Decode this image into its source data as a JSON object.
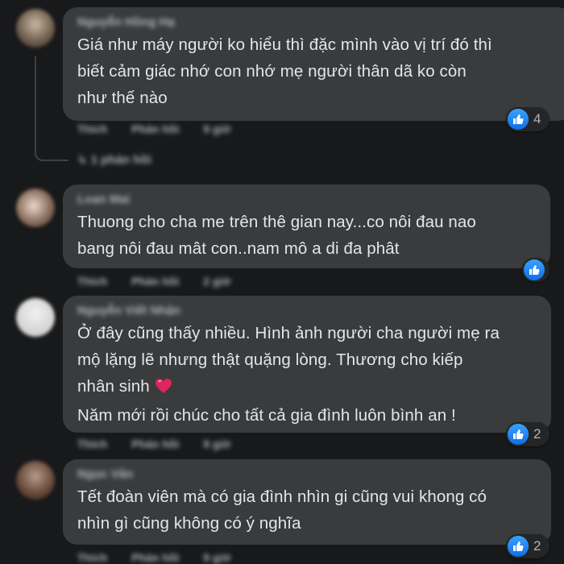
{
  "colors": {
    "background": "#18191a",
    "bubble": "#3a3b3c",
    "text": "#e4e6eb",
    "secondary_text": "#b0b3b8",
    "like_blue": "#1877f2"
  },
  "comments": [
    {
      "author": "Nguyễn Hồng Hạ",
      "text": "Giá như máy người ko hiểu thì đặc mình vào vị trí đó thì\nbiết cảm giác nhớ con nhớ mẹ người thân dã ko còn\nnhư thế nào",
      "actions": {
        "like": "Thích",
        "reply": "Phản hồi",
        "time": "9 giờ"
      },
      "reaction_icon": "like-icon",
      "reaction_count": "4",
      "replies_label": "1 phản hồi"
    },
    {
      "author": "Loan Mai",
      "text": "Thuong cho cha me trên thê gian nay...co nôi đau nao\nbang nôi đau mât con..nam mô a di đa phât",
      "actions": {
        "like": "Thích",
        "reply": "Phản hồi",
        "time": "2 giờ"
      },
      "reaction_icon": "like-icon",
      "reaction_count": ""
    },
    {
      "author": "Nguyễn Viết Nhận",
      "text_line1": "Ở đây cũng thấy nhiều. Hình ảnh người cha người mẹ ra",
      "text_line2": "mộ lặng lẽ nhưng thật quặng lòng. Thương cho kiếp",
      "text_line3": "nhân sinh",
      "emoji_icon": "heart-icon",
      "text_line4": "Năm mới rồi chúc cho tất cả gia đình luôn bình an !",
      "actions": {
        "like": "Thích",
        "reply": "Phản hồi",
        "time": "9 giờ"
      },
      "reaction_icon": "like-icon",
      "reaction_count": "2"
    },
    {
      "author": "Ngọc Vân",
      "text": "Tết đoàn viên mà có gia đình nhìn gi cũng vui khong có\nnhìn gì cũng không có ý nghĩa",
      "actions": {
        "like": "Thích",
        "reply": "Phản hồi",
        "time": "9 giờ"
      },
      "reaction_icon": "like-icon",
      "reaction_count": "2"
    }
  ]
}
